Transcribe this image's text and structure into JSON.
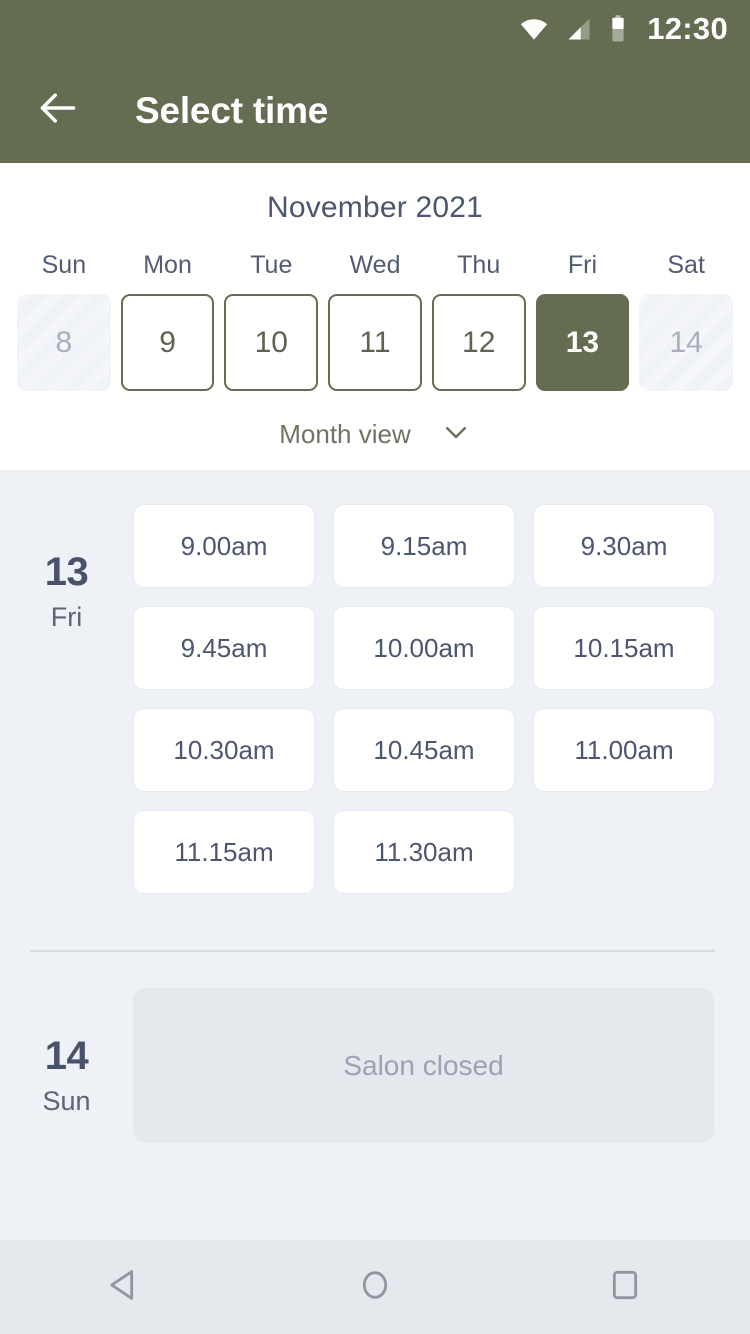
{
  "statusbar": {
    "time": "12:30",
    "icons": [
      "wifi-icon",
      "cellular-signal-icon",
      "battery-icon"
    ]
  },
  "appbar": {
    "title": "Select time",
    "back_icon": "arrow-left-icon"
  },
  "calendar": {
    "month_title": "November 2021",
    "weekdays": [
      "Sun",
      "Mon",
      "Tue",
      "Wed",
      "Thu",
      "Fri",
      "Sat"
    ],
    "days": [
      {
        "number": "8",
        "state": "disabled"
      },
      {
        "number": "9",
        "state": "available"
      },
      {
        "number": "10",
        "state": "available"
      },
      {
        "number": "11",
        "state": "available"
      },
      {
        "number": "12",
        "state": "available"
      },
      {
        "number": "13",
        "state": "selected"
      },
      {
        "number": "14",
        "state": "disabled"
      }
    ],
    "view_toggle_label": "Month view",
    "view_toggle_icon": "chevron-down-icon"
  },
  "schedule": [
    {
      "day_number": "13",
      "day_name": "Fri",
      "slots": [
        "9.00am",
        "9.15am",
        "9.30am",
        "9.45am",
        "10.00am",
        "10.15am",
        "10.30am",
        "10.45am",
        "11.00am",
        "11.15am",
        "11.30am"
      ]
    },
    {
      "day_number": "14",
      "day_name": "Sun",
      "closed_message": "Salon closed"
    }
  ],
  "navbar": {
    "back_icon": "nav-back-triangle-icon",
    "home_icon": "nav-home-circle-icon",
    "recents_icon": "nav-recents-square-icon"
  },
  "colors": {
    "brand_green": "#646c52",
    "page_background": "#eef1f6",
    "card_white": "#ffffff",
    "slate_text": "#49526a",
    "muted_text": "#9aa3b4",
    "navbar_background": "#e5e8ec"
  }
}
